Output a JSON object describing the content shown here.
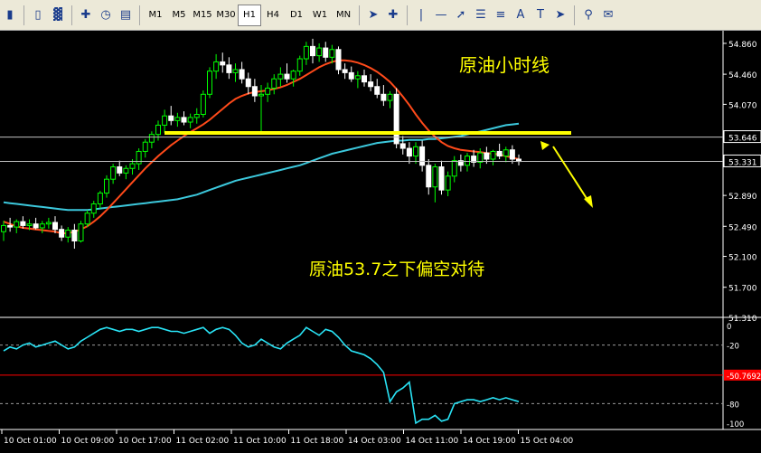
{
  "toolbar": {
    "timeframes": [
      "M1",
      "M5",
      "M15",
      "M30",
      "H1",
      "H4",
      "D1",
      "W1",
      "MN"
    ],
    "active_timeframe": "H1"
  },
  "annotations": {
    "title": "原油小时线",
    "comment": "原油53.7之下偏空对待"
  },
  "colors": {
    "background": "#000000",
    "candle_up": "#00ff00",
    "candle_down": "#ffffff",
    "ma_fast": "#ff4a1a",
    "ma_slow": "#3cc8dc",
    "support_line": "#ffff00",
    "indicator": "#29e3f5",
    "level_line": "#ff0000"
  },
  "chart_data": {
    "type": "line",
    "price_axis": {
      "ticks": [
        "54.860",
        "54.460",
        "54.070",
        "53.646",
        "53.331",
        "52.890",
        "52.490",
        "52.100",
        "51.700",
        "51.310"
      ],
      "ylim": [
        51.31,
        55.0
      ],
      "highlight_labels": [
        "53.646",
        "53.331"
      ]
    },
    "time_axis": {
      "ticks": [
        "10 Oct 01:00",
        "10 Oct 09:00",
        "10 Oct 17:00",
        "11 Oct 02:00",
        "11 Oct 10:00",
        "11 Oct 18:00",
        "14 Oct 03:00",
        "14 Oct 11:00",
        "14 Oct 19:00",
        "15 Oct 04:00"
      ]
    },
    "indicator_axis": {
      "ticks": [
        "0",
        "-20",
        "-50.7692",
        "-80",
        "-100"
      ],
      "ylim": [
        -100,
        0
      ],
      "level": -50.7692
    },
    "levels": {
      "resistance": 53.7,
      "current_line": 53.331,
      "reference_line": 53.646
    },
    "series": [
      {
        "kind": "candles",
        "values": [
          [
            52.42,
            52.56,
            52.3,
            52.5
          ],
          [
            52.5,
            52.6,
            52.42,
            52.48
          ],
          [
            52.48,
            52.58,
            52.4,
            52.55
          ],
          [
            52.55,
            52.62,
            52.46,
            52.5
          ],
          [
            52.5,
            52.58,
            52.44,
            52.52
          ],
          [
            52.52,
            52.6,
            52.45,
            52.47
          ],
          [
            52.47,
            52.56,
            52.4,
            52.52
          ],
          [
            52.52,
            52.6,
            52.46,
            52.54
          ],
          [
            52.54,
            52.62,
            52.4,
            52.45
          ],
          [
            52.45,
            52.5,
            52.3,
            52.35
          ],
          [
            52.35,
            52.48,
            52.28,
            52.44
          ],
          [
            52.44,
            52.52,
            52.2,
            52.3
          ],
          [
            52.3,
            52.56,
            52.28,
            52.52
          ],
          [
            52.52,
            52.7,
            52.48,
            52.66
          ],
          [
            52.66,
            52.82,
            52.6,
            52.78
          ],
          [
            52.78,
            52.95,
            52.72,
            52.92
          ],
          [
            52.92,
            53.15,
            52.86,
            53.1
          ],
          [
            53.1,
            53.3,
            53.04,
            53.26
          ],
          [
            53.26,
            53.34,
            53.14,
            53.18
          ],
          [
            53.18,
            53.28,
            53.1,
            53.24
          ],
          [
            53.24,
            53.36,
            53.16,
            53.3
          ],
          [
            53.3,
            53.5,
            53.22,
            53.46
          ],
          [
            53.46,
            53.62,
            53.38,
            53.58
          ],
          [
            53.58,
            53.72,
            53.5,
            53.68
          ],
          [
            53.68,
            53.86,
            53.6,
            53.8
          ],
          [
            53.8,
            54.0,
            53.7,
            53.92
          ],
          [
            53.92,
            54.05,
            53.8,
            53.86
          ],
          [
            53.86,
            53.96,
            53.78,
            53.9
          ],
          [
            53.9,
            53.98,
            53.8,
            53.84
          ],
          [
            53.84,
            53.95,
            53.76,
            53.9
          ],
          [
            53.9,
            54.02,
            53.82,
            53.94
          ],
          [
            53.94,
            54.25,
            53.9,
            54.2
          ],
          [
            54.2,
            54.55,
            54.15,
            54.5
          ],
          [
            54.5,
            54.72,
            54.4,
            54.62
          ],
          [
            54.62,
            54.74,
            54.48,
            54.58
          ],
          [
            54.58,
            54.68,
            54.4,
            54.48
          ],
          [
            54.48,
            54.6,
            54.36,
            54.52
          ],
          [
            54.52,
            54.62,
            54.34,
            54.4
          ],
          [
            54.4,
            54.48,
            54.2,
            54.3
          ],
          [
            54.3,
            54.4,
            54.1,
            54.18
          ],
          [
            54.18,
            54.32,
            53.7,
            54.2
          ],
          [
            54.2,
            54.35,
            54.1,
            54.28
          ],
          [
            54.28,
            54.46,
            54.2,
            54.4
          ],
          [
            54.4,
            54.55,
            54.3,
            54.46
          ],
          [
            54.46,
            54.6,
            54.35,
            54.4
          ],
          [
            54.4,
            54.52,
            54.3,
            54.5
          ],
          [
            54.5,
            54.7,
            54.44,
            54.66
          ],
          [
            54.66,
            54.88,
            54.58,
            54.82
          ],
          [
            54.82,
            54.92,
            54.6,
            54.7
          ],
          [
            54.7,
            54.86,
            54.62,
            54.8
          ],
          [
            54.8,
            54.88,
            54.62,
            54.68
          ],
          [
            54.68,
            54.84,
            54.6,
            54.78
          ],
          [
            54.78,
            54.82,
            54.46,
            54.52
          ],
          [
            54.52,
            54.6,
            54.4,
            54.48
          ],
          [
            54.48,
            54.56,
            54.36,
            54.4
          ],
          [
            54.4,
            54.5,
            54.28,
            54.44
          ],
          [
            54.44,
            54.52,
            54.3,
            54.36
          ],
          [
            54.36,
            54.46,
            54.24,
            54.3
          ],
          [
            54.3,
            54.4,
            54.15,
            54.2
          ],
          [
            54.2,
            54.32,
            54.05,
            54.12
          ],
          [
            54.12,
            54.24,
            54.02,
            54.2
          ],
          [
            54.2,
            54.28,
            53.5,
            53.56
          ],
          [
            53.56,
            53.66,
            53.42,
            53.5
          ],
          [
            53.5,
            53.58,
            53.3,
            53.4
          ],
          [
            53.4,
            53.58,
            53.3,
            53.52
          ],
          [
            53.52,
            53.6,
            53.2,
            53.28
          ],
          [
            53.28,
            53.36,
            52.9,
            53.0
          ],
          [
            53.0,
            53.3,
            52.8,
            53.26
          ],
          [
            53.26,
            53.34,
            52.9,
            52.96
          ],
          [
            52.96,
            53.2,
            52.88,
            53.14
          ],
          [
            53.14,
            53.4,
            53.06,
            53.34
          ],
          [
            53.34,
            53.42,
            53.2,
            53.28
          ],
          [
            53.28,
            53.44,
            53.2,
            53.4
          ],
          [
            53.4,
            53.48,
            53.26,
            53.32
          ],
          [
            53.32,
            53.5,
            53.24,
            53.44
          ],
          [
            53.44,
            53.52,
            53.3,
            53.36
          ],
          [
            53.36,
            53.48,
            53.28,
            53.46
          ],
          [
            53.46,
            53.56,
            53.36,
            53.4
          ],
          [
            53.4,
            53.52,
            53.32,
            53.48
          ],
          [
            53.48,
            53.54,
            53.3,
            53.36
          ],
          [
            53.36,
            53.42,
            53.28,
            53.33
          ]
        ]
      },
      {
        "kind": "ma_fast",
        "values": [
          52.55,
          52.52,
          52.49,
          52.47,
          52.46,
          52.45,
          52.44,
          52.43,
          52.42,
          52.4,
          52.4,
          52.42,
          52.45,
          52.49,
          52.55,
          52.62,
          52.7,
          52.79,
          52.88,
          52.97,
          53.06,
          53.15,
          53.24,
          53.32,
          53.4,
          53.47,
          53.54,
          53.6,
          53.66,
          53.71,
          53.76,
          53.81,
          53.87,
          53.94,
          54.01,
          54.08,
          54.14,
          54.18,
          54.21,
          54.23,
          54.24,
          54.25,
          54.27,
          54.29,
          54.32,
          54.36,
          54.4,
          54.45,
          54.5,
          54.55,
          54.59,
          54.62,
          54.64,
          54.64,
          54.63,
          54.61,
          54.58,
          54.54,
          54.49,
          54.43,
          54.36,
          54.27,
          54.17,
          54.06,
          53.94,
          53.83,
          53.73,
          53.65,
          53.58,
          53.53,
          53.5,
          53.48,
          53.47,
          53.46,
          53.45,
          53.44,
          53.43,
          53.42,
          53.4,
          53.38,
          53.36
        ]
      },
      {
        "kind": "ma_slow",
        "values": [
          52.8,
          52.79,
          52.78,
          52.77,
          52.76,
          52.75,
          52.74,
          52.73,
          52.72,
          52.71,
          52.7,
          52.7,
          52.7,
          52.7,
          52.71,
          52.72,
          52.73,
          52.74,
          52.75,
          52.76,
          52.77,
          52.78,
          52.79,
          52.8,
          52.81,
          52.82,
          52.83,
          52.84,
          52.86,
          52.88,
          52.9,
          52.93,
          52.96,
          52.99,
          53.02,
          53.05,
          53.08,
          53.1,
          53.12,
          53.14,
          53.16,
          53.18,
          53.2,
          53.22,
          53.24,
          53.26,
          53.28,
          53.31,
          53.34,
          53.37,
          53.4,
          53.43,
          53.45,
          53.47,
          53.49,
          53.51,
          53.53,
          53.55,
          53.57,
          53.58,
          53.59,
          53.6,
          53.6,
          53.61,
          53.61,
          53.61,
          53.62,
          53.62,
          53.63,
          53.64,
          53.65,
          53.66,
          53.68,
          53.7,
          53.72,
          53.74,
          53.76,
          53.78,
          53.8,
          53.81,
          53.82
        ]
      },
      {
        "kind": "indicator",
        "values": [
          -26,
          -22,
          -24,
          -20,
          -18,
          -22,
          -20,
          -18,
          -16,
          -20,
          -24,
          -22,
          -16,
          -12,
          -8,
          -4,
          -2,
          -4,
          -6,
          -4,
          -4,
          -6,
          -4,
          -2,
          -2,
          -4,
          -6,
          -6,
          -8,
          -6,
          -4,
          -2,
          -8,
          -4,
          -2,
          -4,
          -10,
          -18,
          -22,
          -20,
          -14,
          -18,
          -22,
          -24,
          -18,
          -14,
          -10,
          -2,
          -6,
          -10,
          -4,
          -6,
          -12,
          -20,
          -26,
          -28,
          -30,
          -34,
          -40,
          -48,
          -78,
          -68,
          -64,
          -58,
          -100,
          -96,
          -96,
          -92,
          -98,
          -96,
          -80,
          -78,
          -76,
          -76,
          -78,
          -76,
          -74,
          -76,
          -74,
          -76,
          -78
        ]
      }
    ]
  }
}
